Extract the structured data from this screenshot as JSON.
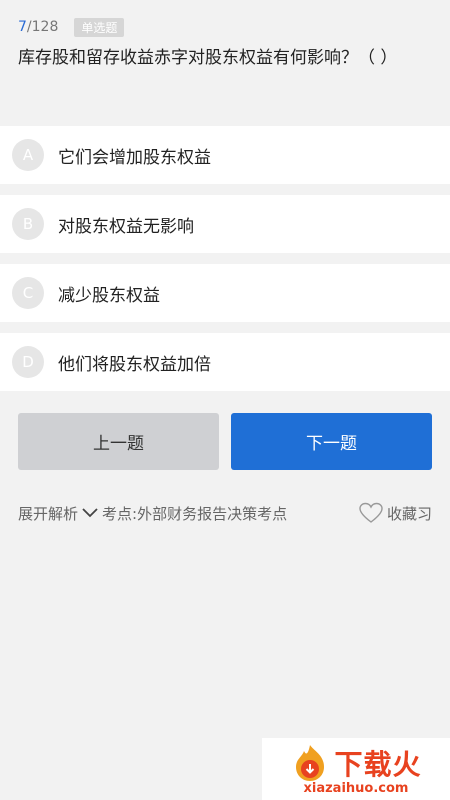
{
  "question": {
    "current": "7",
    "total": "/128",
    "type": "单选题",
    "text": "库存股和留存收益赤字对股东权益有何影响？（    ）"
  },
  "options": [
    {
      "letter": "A",
      "text": "它们会增加股东权益"
    },
    {
      "letter": "B",
      "text": "对股东权益无影响"
    },
    {
      "letter": "C",
      "text": "减少股东权益"
    },
    {
      "letter": "D",
      "text": "他们将股东权益加倍"
    }
  ],
  "nav": {
    "prev": "上一题",
    "next": "下一题"
  },
  "meta": {
    "expand_label": "展开解析",
    "point_label": "考点:外部财务报告决策考点",
    "favorite_label": "收藏习"
  },
  "watermark": {
    "title": "下载火",
    "domain": "xiazaihuo.com"
  },
  "colors": {
    "accent": "#1f6fd6",
    "background": "#f2f2f2",
    "watermark": "#e8421f"
  }
}
